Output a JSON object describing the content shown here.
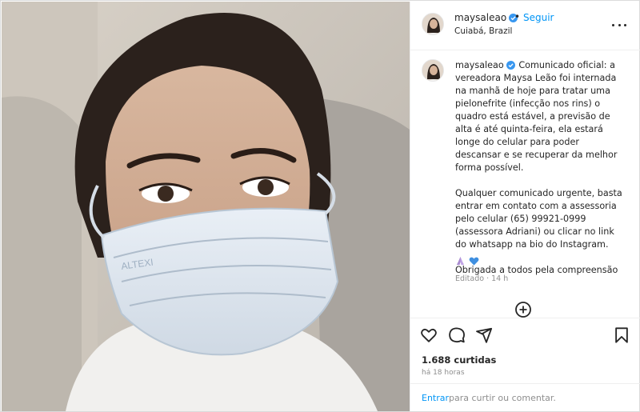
{
  "post": {
    "username": "maysaleao",
    "follow_label": "Seguir",
    "separator": "•",
    "location": "Cuiabá, Brazil",
    "more_icon": "more-horizontal-icon"
  },
  "caption": {
    "username": "maysaleao",
    "paragraph1": "Comunicado oficial: a vereadora Maysa Leão foi internada na manhã de hoje para tratar uma pielonefrite (infecção nos rins) o quadro está estável, a previsão de alta é até quinta-feira, ela estará longe do celular para poder descansar e se recuperar da melhor forma possível.",
    "paragraph2": "Qualquer comunicado urgente, basta entrar em contato com a assessoria pelo celular (65) 99921-0999 (assessora Adriani) ou clicar no link do whatsapp na bio do Instagram.",
    "paragraph3": "Obrigada a todos pela compreensão",
    "emojis": [
      "praying-hands-emoji",
      "blue-heart-emoji"
    ],
    "edited_label": "Editado · 14 h"
  },
  "photo": {
    "mask_print": "ALTEXI"
  },
  "actions": {
    "icons": [
      "heart-icon",
      "comment-icon",
      "share-icon",
      "bookmark-icon"
    ]
  },
  "stats": {
    "likes": "1.688 curtidas",
    "time_ago": "há 18 horas"
  },
  "comment_bar": {
    "enter_label": "Entrar",
    "rest_label": "para curtir ou comentar."
  },
  "colors": {
    "link_blue": "#0095f6",
    "verified_blue": "#3897f0",
    "text": "#262626",
    "muted": "#8e8e8e"
  }
}
